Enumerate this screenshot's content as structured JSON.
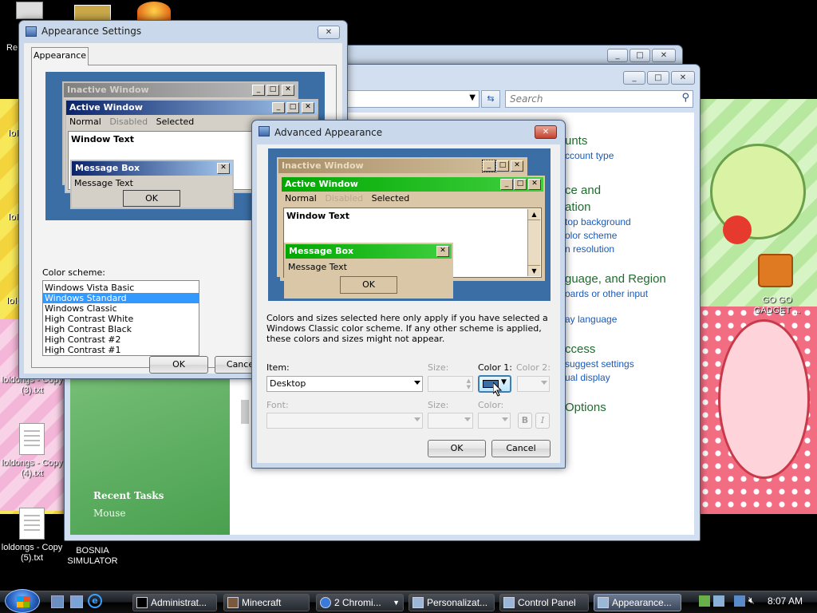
{
  "desktop": {
    "icons": [
      {
        "label": "Re",
        "icon": "recycle-bin-icon"
      },
      {
        "label": "loldongs - Copy (3).txt",
        "icon": "text-file-icon"
      },
      {
        "label": "loldongs - Copy (4).txt",
        "icon": "text-file-icon"
      },
      {
        "label": "loldongs - Copy (5).txt",
        "icon": "text-file-icon"
      },
      {
        "label": "BOSNIA SIMULATOR",
        "icon": "application-icon"
      },
      {
        "label": "GO GO GADGET ...",
        "icon": "briefcase-icon"
      }
    ],
    "partial_labels": [
      "lol",
      "lold",
      "lold C",
      "lold Co",
      "loldongs"
    ]
  },
  "control_panel": {
    "search_placeholder": "Search",
    "headings": [
      "unts",
      "ce and",
      "ation",
      "guage, and Region",
      "ccess",
      "Options"
    ],
    "links": [
      "ccount type",
      "top background",
      "olor scheme",
      "n resolution",
      "oards or other input",
      "ay language",
      "suggest settings",
      "ual display"
    ],
    "recent_tasks_title": "Recent Tasks",
    "recent_tasks": [
      "Mouse"
    ]
  },
  "appearance_settings": {
    "title": "Appearance Settings",
    "tab": "Appearance",
    "preview": {
      "inactive_title": "Inactive Window",
      "active_title": "Active Window",
      "menu": [
        "Normal",
        "Disabled",
        "Selected"
      ],
      "window_text": "Window Text",
      "msgbox_title": "Message Box",
      "msgbox_text": "Message Text",
      "msgbox_ok": "OK"
    },
    "color_scheme_label": "Color scheme:",
    "color_schemes": [
      "Windows Vista Basic",
      "Windows Standard",
      "Windows Classic",
      "High Contrast White",
      "High Contrast Black",
      "High Contrast #2",
      "High Contrast #1"
    ],
    "selected_scheme": "Windows Standard",
    "ok": "OK",
    "cancel": "Cance"
  },
  "advanced_appearance": {
    "title": "Advanced Appearance",
    "preview": {
      "inactive_title": "Inactive Window",
      "active_title": "Active Window",
      "menu": [
        "Normal",
        "Disabled",
        "Selected"
      ],
      "window_text": "Window Text",
      "msgbox_title": "Message Box",
      "msgbox_text": "Message Text",
      "msgbox_ok": "OK"
    },
    "note": "Colors and sizes selected here only apply if you have selected a Windows Classic color scheme. If any other scheme is applied, these colors and sizes might not appear.",
    "item_label": "Item:",
    "item_value": "Desktop",
    "size_label": "Size:",
    "color1_label": "Color 1:",
    "color2_label": "Color 2:",
    "font_label": "Font:",
    "font_size_label": "Size:",
    "font_color_label": "Color:",
    "bold": "B",
    "italic": "I",
    "color1_value": "#3a6ea5",
    "ok": "OK",
    "cancel": "Cancel"
  },
  "taskbar": {
    "buttons": [
      "Administrat...",
      "Minecraft",
      "2 Chromi...",
      "Personalizat...",
      "Control Panel",
      "Appearance..."
    ],
    "clock": "8:07 AM"
  },
  "colors": {
    "classic_desktop": "#3a6ea5",
    "inactive_brown": "#a89068",
    "active_green": "#00b000",
    "sel_blue": "#3399ff"
  }
}
